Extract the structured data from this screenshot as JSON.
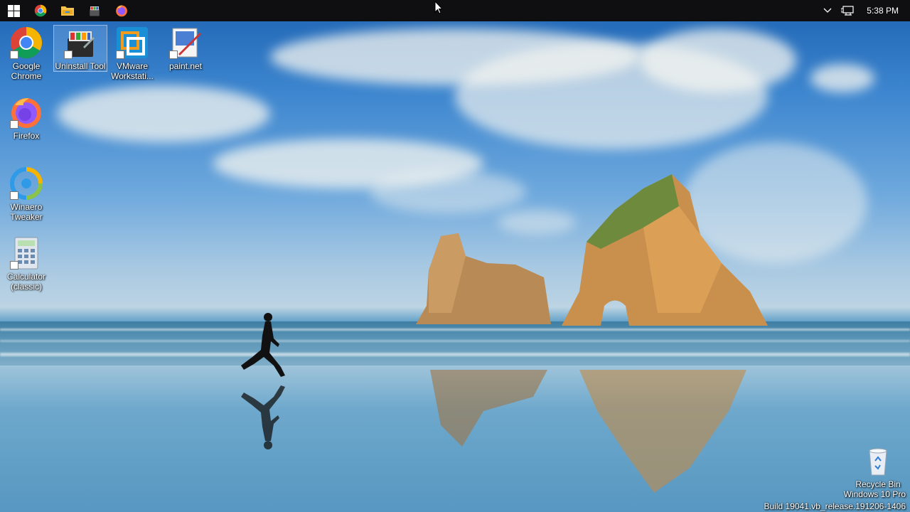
{
  "taskbar": {
    "start_icon": "windows-start-icon",
    "pinned": [
      {
        "name": "chrome-taskbar-icon",
        "title": "Google Chrome"
      },
      {
        "name": "file-explorer-taskbar-icon",
        "title": "File Explorer"
      },
      {
        "name": "uninstall-tool-taskbar-icon",
        "title": "Uninstall Tool"
      },
      {
        "name": "firefox-taskbar-icon",
        "title": "Firefox"
      }
    ],
    "tray": {
      "chevron_icon": "chevron-up-icon",
      "network_icon": "network-icon",
      "clock": "5:38 PM"
    }
  },
  "desktop": {
    "icons": [
      {
        "id": "google-chrome",
        "label": "Google Chrome",
        "icon": "chrome-icon"
      },
      {
        "id": "uninstall-tool",
        "label": "Uninstall Tool",
        "icon": "uninstall-tool-icon",
        "selected": true
      },
      {
        "id": "vmware",
        "label": "VMware Workstati...",
        "icon": "vmware-icon"
      },
      {
        "id": "paint-net",
        "label": "paint.net",
        "icon": "paint-net-icon"
      },
      {
        "id": "firefox",
        "label": "Firefox",
        "icon": "firefox-icon"
      },
      {
        "id": "winaero",
        "label": "Winaero Tweaker",
        "icon": "winaero-icon"
      },
      {
        "id": "calculator",
        "label": "Calculator (classic)",
        "icon": "calculator-icon"
      },
      {
        "id": "recycle-bin",
        "label": "Recycle Bin",
        "icon": "recycle-bin-icon"
      }
    ],
    "watermark": {
      "edition": "Windows 10 Pro",
      "build": "Build 19041.vb_release.191206-1406"
    }
  },
  "colors": {
    "taskbar": "#0f0f12",
    "sky_top": "#1d63b3",
    "sea": "#3b7fa8"
  }
}
